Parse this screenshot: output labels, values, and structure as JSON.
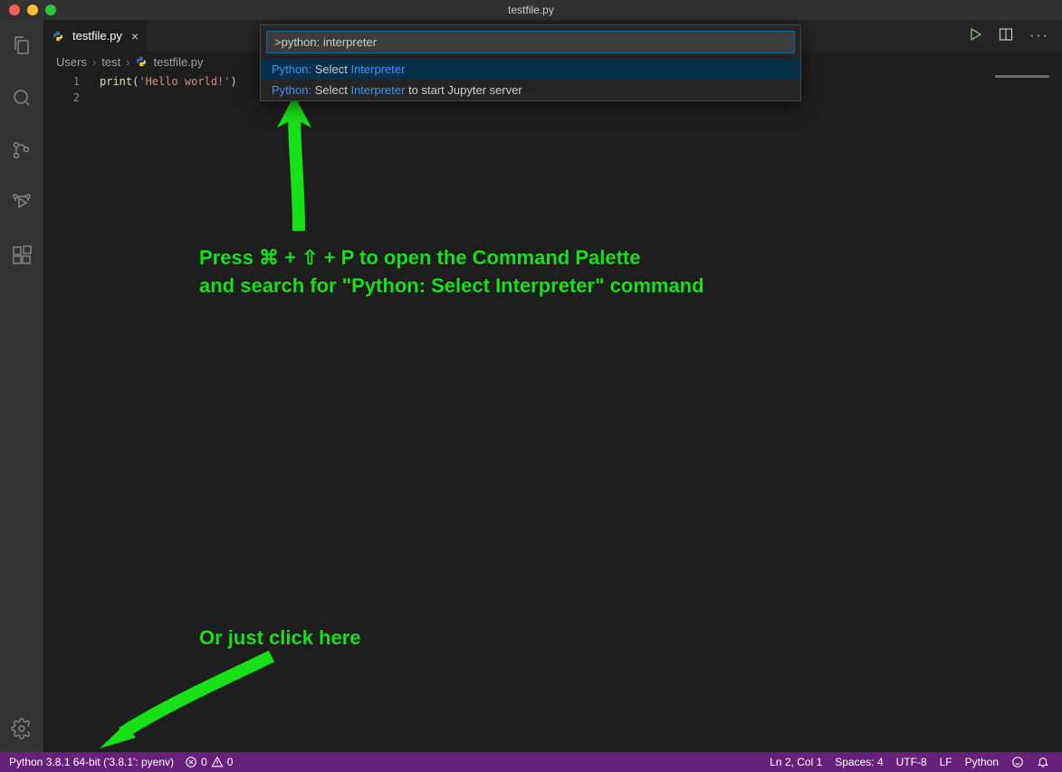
{
  "titlebar": {
    "title": "testfile.py"
  },
  "tab": {
    "label": "testfile.py"
  },
  "breadcrumbs": {
    "seg1": "Users",
    "seg2": "test",
    "seg3": "testfile.py"
  },
  "editor": {
    "lineNumbers": [
      "1",
      "2"
    ],
    "code_fn": "print",
    "code_open": "(",
    "code_str": "'Hello world!'",
    "code_close": ")"
  },
  "palette": {
    "input": ">python: interpreter",
    "rows": [
      {
        "prefix": "Python:",
        "plain1": " Select ",
        "match": "Interpreter",
        "plain2": ""
      },
      {
        "prefix": "Python:",
        "plain1": " Select ",
        "match": "Interpreter",
        "plain2": " to start Jupyter server"
      }
    ]
  },
  "statusbar": {
    "interpreter": "Python 3.8.1 64-bit ('3.8.1': pyenv)",
    "errors": "0",
    "warnings": "0",
    "lncol": "Ln 2, Col 1",
    "spaces": "Spaces: 4",
    "encoding": "UTF-8",
    "eol": "LF",
    "lang": "Python"
  },
  "annotation": {
    "line1": "Press ⌘ + ⇧ + P to open the Command Palette",
    "line2": "and search for \"Python: Select Interpreter\" command",
    "line3": "Or just click here"
  }
}
